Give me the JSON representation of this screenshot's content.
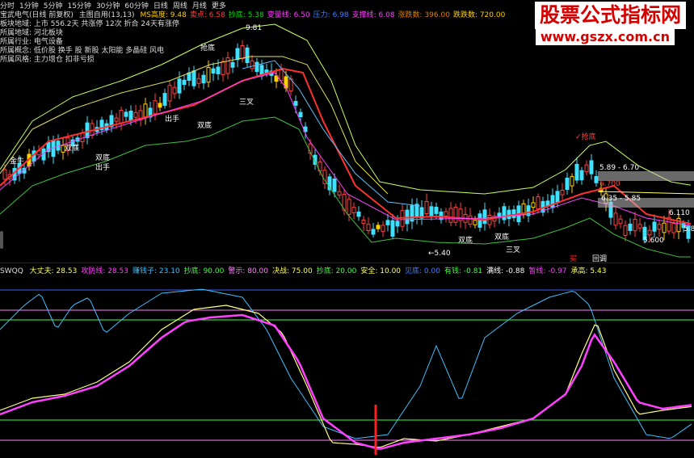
{
  "toolbar": {
    "periods": [
      "分时",
      "1分钟",
      "5分钟",
      "15分钟",
      "30分钟",
      "60分钟",
      "日线",
      "周线",
      "月线",
      "更多"
    ]
  },
  "price_bar": {
    "title": "宝武电气(日线 前复权)",
    "main_label": "主图自用(13,13)",
    "items": [
      {
        "label": "MS高度: 9.48",
        "color": "#ffd000"
      },
      {
        "label": "卖点: 6.58",
        "color": "#ff4040"
      },
      {
        "label": "抄底: 5.38",
        "color": "#00e000"
      },
      {
        "label": "变量线: 6.50",
        "color": "#ff40ff"
      },
      {
        "label": "压力: 6.98",
        "color": "#4080ff"
      },
      {
        "label": "支撑线: 6.08",
        "color": "#ff40ff"
      },
      {
        "label": "涨跌数: 396.00",
        "color": "#e08000"
      },
      {
        "label": "跌跌数: 720.00",
        "color": "#ffd000"
      }
    ]
  },
  "info_lines": [
    {
      "text": "板块地域: 上市  556.2天   共涨停 12次   折合 24天有涨停",
      "color": "#dddddd"
    },
    {
      "text": "所属地域: 河北板块",
      "color": "#dddddd"
    },
    {
      "text": "所属行业: 电气设备",
      "color": "#dddddd"
    },
    {
      "text": "所属概念: 低价股 换手 股 新股 太阳能 多晶硅 风电",
      "color": "#dddddd"
    },
    {
      "text": "所属风格: 主力增仓 扣非亏损",
      "color": "#dddddd"
    }
  ],
  "chart_labels": [
    {
      "text": "9.81",
      "color": "#ffffff"
    },
    {
      "text": "抢底",
      "color": "#ffffff"
    },
    {
      "text": "双底",
      "color": "#ffffff"
    },
    {
      "text": "金牛",
      "color": "#ffffff"
    },
    {
      "text": "双底",
      "color": "#ffffff"
    },
    {
      "text": "出手",
      "color": "#ffffff"
    },
    {
      "text": "出手",
      "color": "#ffffff"
    },
    {
      "text": "三叉",
      "color": "#ffffff"
    },
    {
      "text": "双底",
      "color": "#ffffff"
    },
    {
      "text": "←5.40",
      "color": "#ffffff"
    },
    {
      "text": "双底",
      "color": "#ffffff"
    },
    {
      "text": "双底",
      "color": "#ffffff"
    },
    {
      "text": "三叉",
      "color": "#ffffff"
    },
    {
      "text": "✓抢底",
      "color": "#ff4040"
    },
    {
      "text": "5.89 - 6.70",
      "color": "#ffffff"
    },
    {
      "text": "6.700",
      "color": "#ff4040"
    },
    {
      "text": "6.35 - 5.85",
      "color": "#ffffff"
    },
    {
      "text": "6.110",
      "color": "#ffffff"
    },
    {
      "text": "5.600",
      "color": "#ffffff"
    },
    {
      "text": "5.8",
      "color": "#ffffff"
    },
    {
      "text": "买",
      "color": "#ff3030"
    },
    {
      "text": "回调",
      "color": "#ffffff"
    }
  ],
  "indicator_bar": {
    "name": "SWQQ",
    "items": [
      {
        "label": "大丈夫: 28.53",
        "color": "#ffff60"
      },
      {
        "label": "攻防线: 28.53",
        "color": "#ff40ff"
      },
      {
        "label": "赚钱子: 23.10",
        "color": "#40c0ff"
      },
      {
        "label": "抄底: 90.00",
        "color": "#40ff40"
      },
      {
        "label": "警示: 80.00",
        "color": "#ff80ff"
      },
      {
        "label": "决战: 75.00",
        "color": "#ffff60"
      },
      {
        "label": "抄底: 20.00",
        "color": "#40ff40"
      },
      {
        "label": "安全: 10.00",
        "color": "#ffff60"
      },
      {
        "label": "见底: 0.00",
        "color": "#4080ff"
      },
      {
        "label": "有钱: -0.81",
        "color": "#40ff40"
      },
      {
        "label": "满线: -0.88",
        "color": "#ffffff"
      },
      {
        "label": "暂线: -0.97",
        "color": "#ff40ff"
      },
      {
        "label": "承高: 5.43",
        "color": "#ffff60"
      }
    ]
  },
  "watermark": {
    "title": "股票公式指标网",
    "url": "www.gszx.com.cn"
  },
  "colors": {
    "background": "#000000",
    "up": "#ff4040",
    "down": "#40e0ff",
    "accent_red": "#ff3030",
    "magenta": "#ff40ff",
    "yellow": "#ffff60",
    "cyan": "#40c0ff",
    "green": "#40d040"
  }
}
